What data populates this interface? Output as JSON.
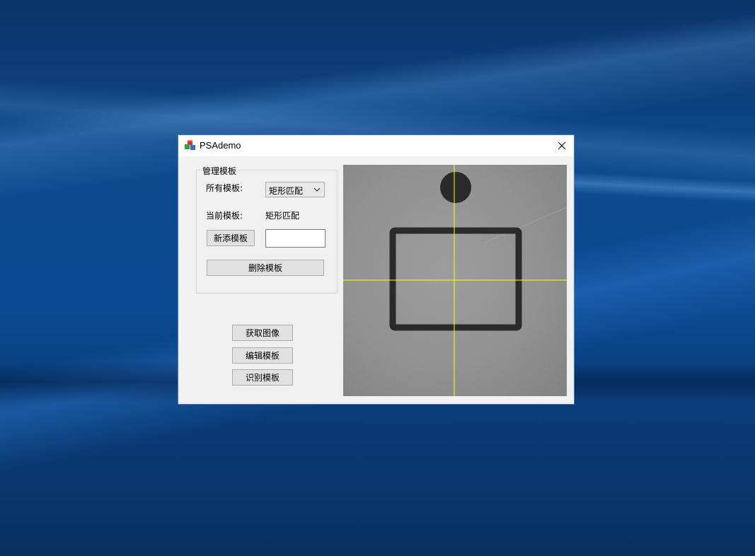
{
  "window": {
    "title": "PSAdemo",
    "close_label": "×"
  },
  "icons": {
    "app": "app-blocks-icon",
    "close": "close-icon",
    "dropdown": "chevron-down-icon"
  },
  "template_group": {
    "title": "管理模板",
    "all_templates_label": "所有模板:",
    "template_select": {
      "selected": "矩形匹配"
    },
    "current_template_label": "当前模板:",
    "current_template_value": "矩形匹配",
    "add_button": "新添模板",
    "new_template_input": {
      "value": ""
    },
    "delete_button": "删除模板"
  },
  "actions": {
    "capture_image": "获取图像",
    "edit_template": "编辑模板",
    "recognize_template": "识别模板"
  },
  "viewer": {
    "crosshair_color": "#ffff00"
  },
  "colors": {
    "window_border": "#3b7ad8",
    "window_bg": "#f0f0f0"
  }
}
